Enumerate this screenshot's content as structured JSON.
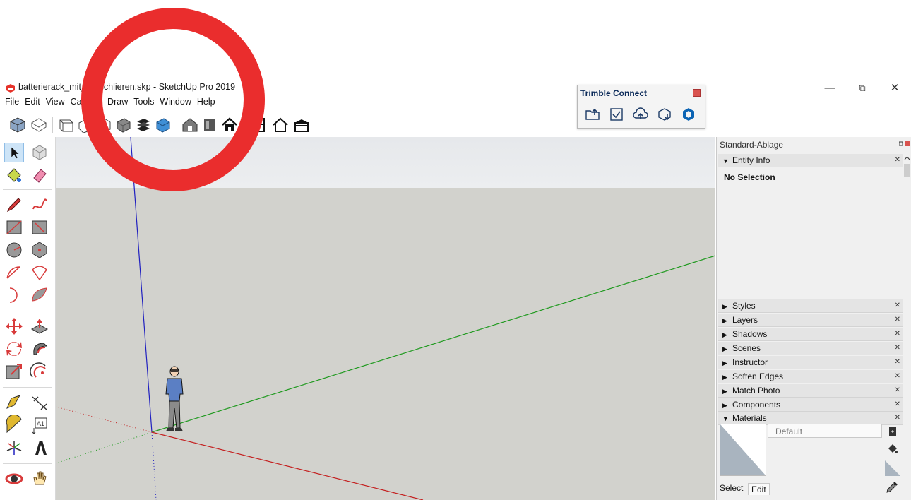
{
  "window": {
    "title": "batterierack_mit_lis_schlieren.skp - SketchUp Pro 2019",
    "controls": {
      "minimize": "—",
      "restore": "⧉",
      "close": "✕"
    }
  },
  "menu": [
    "File",
    "Edit",
    "View",
    "Camera",
    "Draw",
    "Tools",
    "Window",
    "Help"
  ],
  "top_toolbar": {
    "icons": [
      "iso-view-icon",
      "top-view-icon",
      "front-view-icon",
      "right-view-icon",
      "back-view-icon",
      "left-view-icon",
      "bottom-view-icon",
      "xray-icon",
      "back-edges-icon",
      "wireframe-icon",
      "hidden-line-icon",
      "shaded-icon",
      "shaded-textures-icon",
      "monochrome-icon",
      "warehouse-icon",
      "extension-icon",
      "house-icon",
      "house-outline-icon",
      "warehouse-roof-icon"
    ]
  },
  "trimble_connect": {
    "title": "Trimble Connect",
    "icons": [
      "open-folder-icon",
      "sync-check-icon",
      "cloud-upload-icon",
      "box-download-icon",
      "trimble-logo-icon"
    ]
  },
  "left_toolbar": {
    "icons": [
      "select-icon",
      "component-icon",
      "paint-bucket-icon",
      "eraser-icon",
      "pencil-icon",
      "freehand-icon",
      "rectangle-icon",
      "rotated-rectangle-icon",
      "circle-icon",
      "polygon-icon",
      "arc-icon",
      "pie-icon",
      "two-point-arc-icon",
      "three-point-arc-icon",
      "move-icon",
      "push-pull-icon",
      "rotate-icon",
      "follow-me-icon",
      "scale-icon",
      "offset-icon",
      "tape-measure-icon",
      "dimension-icon",
      "protractor-icon",
      "text-icon",
      "axes-icon",
      "3d-text-icon",
      "orbit-icon",
      "pan-icon"
    ]
  },
  "tray": {
    "title": "Standard-Ablage",
    "entity_info": {
      "label": "Entity Info",
      "status": "No Selection"
    },
    "panels": [
      "Styles",
      "Layers",
      "Shadows",
      "Scenes",
      "Instructor",
      "Soften Edges",
      "Match Photo",
      "Components",
      "Materials"
    ],
    "materials": {
      "name": "Default",
      "tabs": {
        "select": "Select",
        "edit": "Edit"
      }
    }
  },
  "colors": {
    "annotation_ring": "#ea2d2d",
    "axis_blue": "#2020c0",
    "axis_green": "#1f9a1f",
    "axis_red": "#c42020",
    "viewport_ground": "#d2d2cd"
  }
}
